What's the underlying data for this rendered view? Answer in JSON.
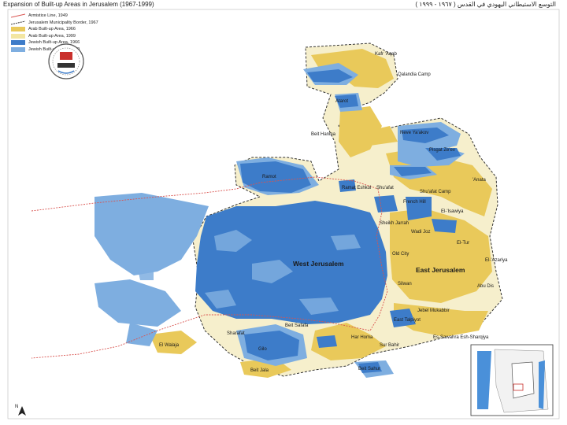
{
  "title_en": "Expansion of Built-up Areas in Jerusalem (1967-1999)",
  "title_ar": "التوسع الاستيطاني اليهودي في القدس ( ١٩٦٧ - ١٩٩٩ )",
  "legend": [
    {
      "label": "Armistice Line, 1949",
      "color": "#d9534f",
      "kind": "line"
    },
    {
      "label": "Jerusalem Municipality Border, 1967",
      "color": "#333333",
      "kind": "dash"
    },
    {
      "label": "Arab Built-up Area, 1966",
      "color": "#e9c95a",
      "kind": "fill"
    },
    {
      "label": "Arab Built-up Area, 1999",
      "color": "#f3e6a2",
      "kind": "fill"
    },
    {
      "label": "Jewish Built-up Area, 1966",
      "color": "#3d7cc9",
      "kind": "fill"
    },
    {
      "label": "Jewish Built-up Area, 1999",
      "color": "#7eaee0",
      "kind": "fill"
    }
  ],
  "colors": {
    "arab_1966": "#e9c95a",
    "arab_1999": "#f3e6a2",
    "jewish_1966": "#3d7cc9",
    "jewish_1999": "#7eaee0",
    "armistice": "#d9534f",
    "border": "#333333",
    "sea": "#4a90d9"
  },
  "places": {
    "kafr_aqab": "Kafr 'Aqab",
    "qalandia_camp": "Qalandia Camp",
    "bet_hanina": "Beit Hanina",
    "atarot": "Atarot",
    "neve_yaakov": "Neve Ya'akov",
    "pisgat_zeev": "Pisgat Ze'ev",
    "shuafat": "Shu'afat",
    "shuafat_camp": "Shu'afat Camp",
    "ramot": "Ramot",
    "ramat_eshkol": "Ramat Eshkol",
    "anata": "'Anata",
    "french_hill": "French Hill",
    "sheikh_jarrah": "Sheikh Jarrah",
    "el_tur": "El-Tur",
    "el_isawiya": "El-'Isawiya",
    "wadi_joz": "Wadi Joz",
    "west_jerusalem": "West Jerusalem",
    "east_jerusalem": "East Jerusalem",
    "old_city": "Old City",
    "silwan": "Silwan",
    "el_azariya": "El-'Azariya",
    "abu_dis": "Abu Dis",
    "talpiyot": "East Talpiyot",
    "jabal_mukabbir": "Jebel Mukabbir",
    "sawahra": "Es-Sawahra Esh-Sharqiya",
    "gilo": "Gilo",
    "sur_bahir": "Sur Bahir",
    "beit_safafa": "Beit Safafa",
    "el_walaja": "El Walaja",
    "sharafat": "Sharafat",
    "har_homa": "Har Homa",
    "beit_jala": "Beit Jala",
    "beit_sahur": "Beit Sahur"
  },
  "north_label": "N"
}
